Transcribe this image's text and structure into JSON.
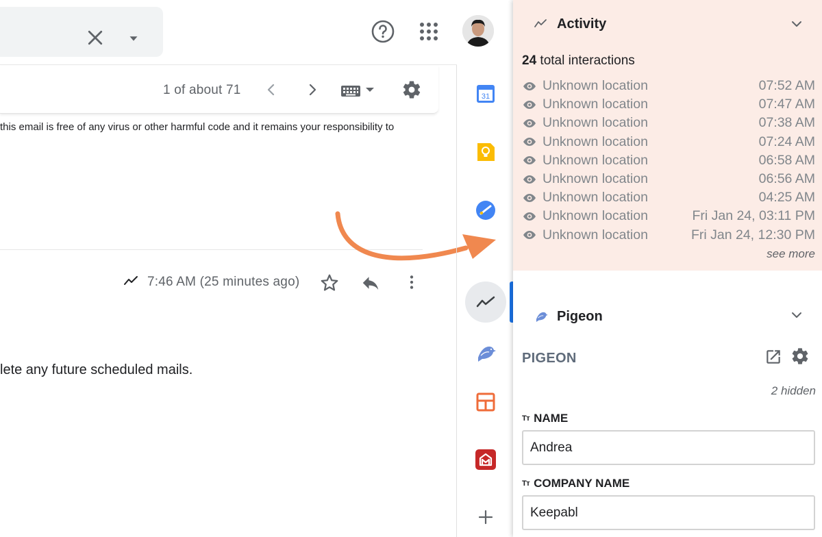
{
  "header": {
    "search_clear": "clear-search",
    "search_options": "search-options"
  },
  "toolbar": {
    "page_count": "1 of about 71"
  },
  "mail": {
    "disclaimer": "this email is free of any virus or other harmful code and it remains your responsibility to",
    "timestamp": "7:46 AM (25 minutes ago)",
    "body": "lete any future scheduled mails."
  },
  "side_strip": {
    "calendar_day": "31"
  },
  "activity": {
    "title": "Activity",
    "total_count": "24",
    "total_label": "total interactions",
    "rows": [
      {
        "location": "Unknown location",
        "time": "07:52 AM"
      },
      {
        "location": "Unknown location",
        "time": "07:47 AM"
      },
      {
        "location": "Unknown location",
        "time": "07:38 AM"
      },
      {
        "location": "Unknown location",
        "time": "07:24 AM"
      },
      {
        "location": "Unknown location",
        "time": "06:58 AM"
      },
      {
        "location": "Unknown location",
        "time": "06:56 AM"
      },
      {
        "location": "Unknown location",
        "time": "04:25 AM"
      },
      {
        "location": "Unknown location",
        "time": "Fri Jan 24, 03:11 PM"
      },
      {
        "location": "Unknown location",
        "time": "Fri Jan 24, 12:30 PM"
      }
    ],
    "see_more": "see more"
  },
  "pigeon": {
    "title": "Pigeon",
    "label": "PIGEON",
    "hidden_count": "2 hidden",
    "fields": [
      {
        "type_glyph": "Tт",
        "label": "NAME",
        "value": "Andrea"
      },
      {
        "type_glyph": "Tт",
        "label": "COMPANY NAME",
        "value": "Keepabl"
      }
    ]
  },
  "colors": {
    "activity_bg": "#fcece6",
    "arrow": "#f0884f",
    "active_bar": "#1a73e8"
  }
}
